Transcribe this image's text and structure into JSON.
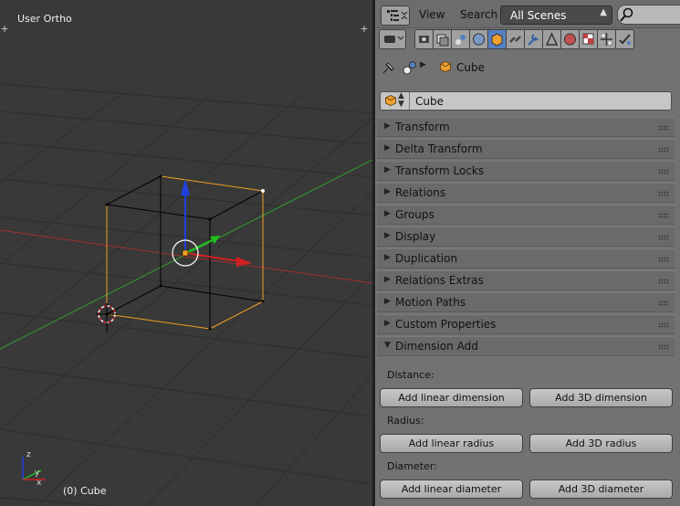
{
  "viewport": {
    "view_name": "User Ortho",
    "object_info": "(0) Cube",
    "axis_labels": {
      "x": "x",
      "y": "y",
      "z": "z"
    }
  },
  "header": {
    "menu": [
      "View",
      "Search"
    ],
    "scene_select": "All Scenes"
  },
  "context": {
    "object_name": "Cube"
  },
  "name_field": {
    "value": "Cube"
  },
  "panels": [
    {
      "label": "Transform",
      "expanded": false
    },
    {
      "label": "Delta Transform",
      "expanded": false
    },
    {
      "label": "Transform Locks",
      "expanded": false
    },
    {
      "label": "Relations",
      "expanded": false
    },
    {
      "label": "Groups",
      "expanded": false
    },
    {
      "label": "Display",
      "expanded": false
    },
    {
      "label": "Duplication",
      "expanded": false
    },
    {
      "label": "Relations Extras",
      "expanded": false
    },
    {
      "label": "Motion Paths",
      "expanded": false
    },
    {
      "label": "Custom Properties",
      "expanded": false
    },
    {
      "label": "Dimension Add",
      "expanded": true
    }
  ],
  "dimension_add": {
    "distance_label": "Distance:",
    "add_linear_dimension": "Add linear dimension",
    "add_3d_dimension": "Add 3D dimension",
    "radius_label": "Radius:",
    "add_linear_radius": "Add linear radius",
    "add_3d_radius": "Add 3D radius",
    "diameter_label": "Diameter:",
    "add_linear_diameter": "Add linear diameter",
    "add_3d_diameter": "Add 3D diameter"
  },
  "colors": {
    "active_tab": "#5680c2",
    "selection_orange": "#f0a020",
    "x_axis": "#d02020",
    "y_axis": "#20c020",
    "z_axis": "#2040e0"
  },
  "property_tabs": [
    "render-icon",
    "render-layers-icon",
    "scene-icon",
    "world-icon",
    "object-icon",
    "constraints-icon",
    "modifiers-icon",
    "data-icon",
    "material-icon",
    "texture-icon",
    "particles-icon",
    "physics-icon"
  ]
}
